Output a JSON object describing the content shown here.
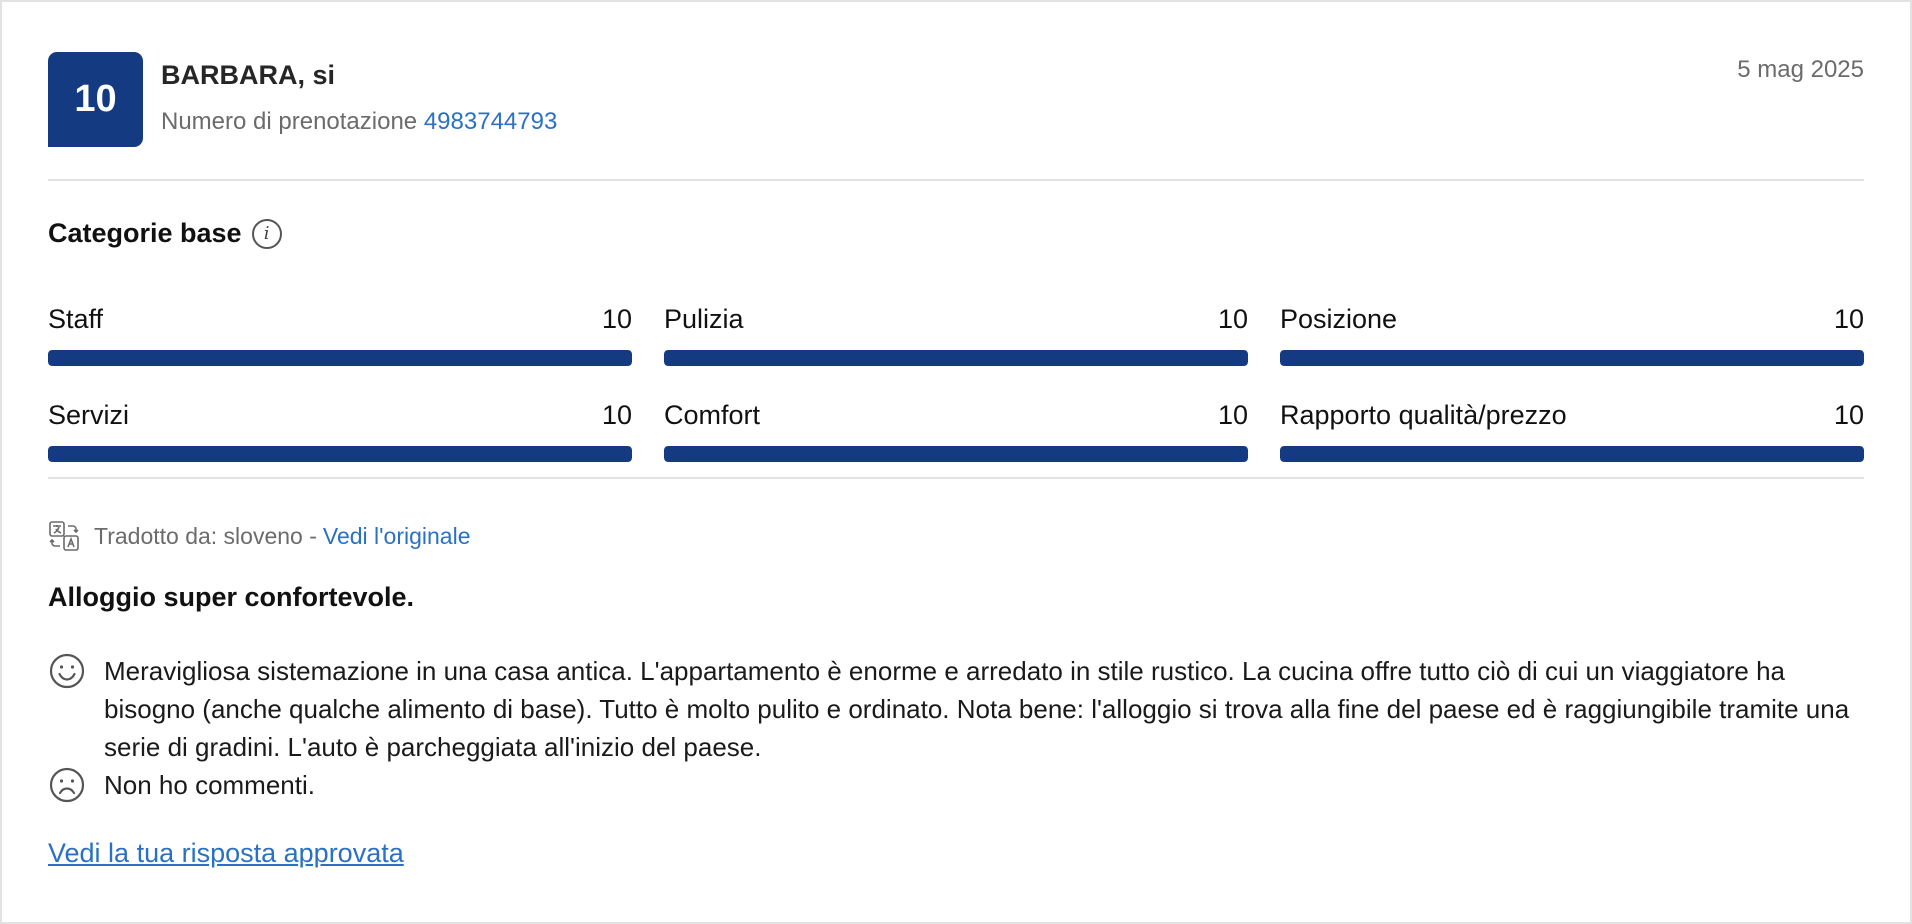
{
  "review": {
    "score": "10",
    "guest_name": "BARBARA, si",
    "booking_label": "Numero di prenotazione",
    "booking_number": "4983744793",
    "date": "5 mag 2025"
  },
  "categories": {
    "title": "Categorie base",
    "info_icon": "info-icon",
    "items": [
      {
        "label": "Staff",
        "score": "10",
        "fraction": 1.0
      },
      {
        "label": "Pulizia",
        "score": "10",
        "fraction": 1.0
      },
      {
        "label": "Posizione",
        "score": "10",
        "fraction": 1.0
      },
      {
        "label": "Servizi",
        "score": "10",
        "fraction": 1.0
      },
      {
        "label": "Comfort",
        "score": "10",
        "fraction": 1.0
      },
      {
        "label": "Rapporto qualità/prezzo",
        "score": "10",
        "fraction": 1.0
      }
    ],
    "bar_color": "#143a82"
  },
  "translation": {
    "text": "Tradotto da: sloveno -",
    "link": "Vedi l'originale",
    "icon": "translate-icon"
  },
  "content": {
    "title": "Alloggio super confortevole.",
    "positive": "Meravigliosa sistemazione in una casa antica. L'appartamento è enorme e arredato in stile rustico. La cucina offre tutto ciò di cui un viaggiatore ha bisogno (anche qualche alimento di base). Tutto è molto pulito e ordinato. Nota bene: l'alloggio si trova alla fine del paese ed è raggiungibile tramite una serie di gradini. L'auto è parcheggiata all'inizio del paese.",
    "negative": "Non ho commenti.",
    "positive_icon": "smiley-happy-icon",
    "negative_icon": "smiley-sad-icon"
  },
  "approved_link": "Vedi la tua risposta approvata",
  "colors": {
    "brand": "#143a82",
    "link": "#2a71c5",
    "muted": "#6b6b6b"
  }
}
